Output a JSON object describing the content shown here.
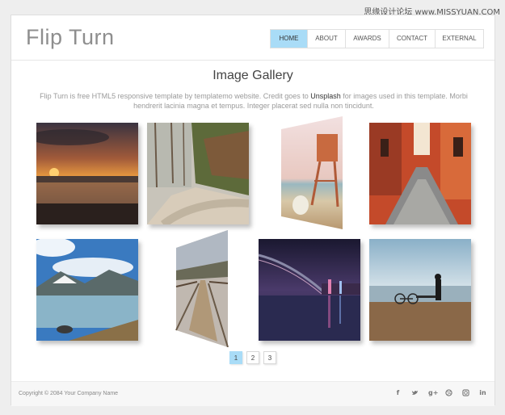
{
  "watermark": "思缘设计论坛 www.MISSYUAN.COM",
  "header": {
    "logo": "Flip Turn"
  },
  "nav": {
    "items": [
      {
        "label": "HOME",
        "active": true
      },
      {
        "label": "ABOUT",
        "active": false
      },
      {
        "label": "AWARDS",
        "active": false
      },
      {
        "label": "CONTACT",
        "active": false
      },
      {
        "label": "EXTERNAL",
        "active": false
      }
    ]
  },
  "gallery": {
    "title": "Image Gallery",
    "desc_part1": "Flip Turn is free HTML5 responsive template by templatemo website. Credit goes to ",
    "desc_link": "Unsplash",
    "desc_part2": " for images used in this template. Morbi hendrerit lacinia magna et tempus. Integer placerat sed nulla non tincidunt.",
    "images": [
      {
        "name": "sunset-beach"
      },
      {
        "name": "forest-road"
      },
      {
        "name": "lifeguard-tower"
      },
      {
        "name": "old-street"
      },
      {
        "name": "mountain-lake"
      },
      {
        "name": "wooden-bridge"
      },
      {
        "name": "city-bridge-night"
      },
      {
        "name": "beach-cyclist"
      }
    ]
  },
  "pagination": {
    "pages": [
      "1",
      "2",
      "3"
    ],
    "active": "1"
  },
  "footer": {
    "copyright": "Copyright © 2084 Your Company Name",
    "socials": [
      "facebook-icon",
      "twitter-icon",
      "google-plus-icon",
      "dribbble-icon",
      "instagram-icon",
      "linkedin-icon"
    ]
  },
  "colors": {
    "accent": "#a9dcf7",
    "background": "#eeeeee"
  }
}
